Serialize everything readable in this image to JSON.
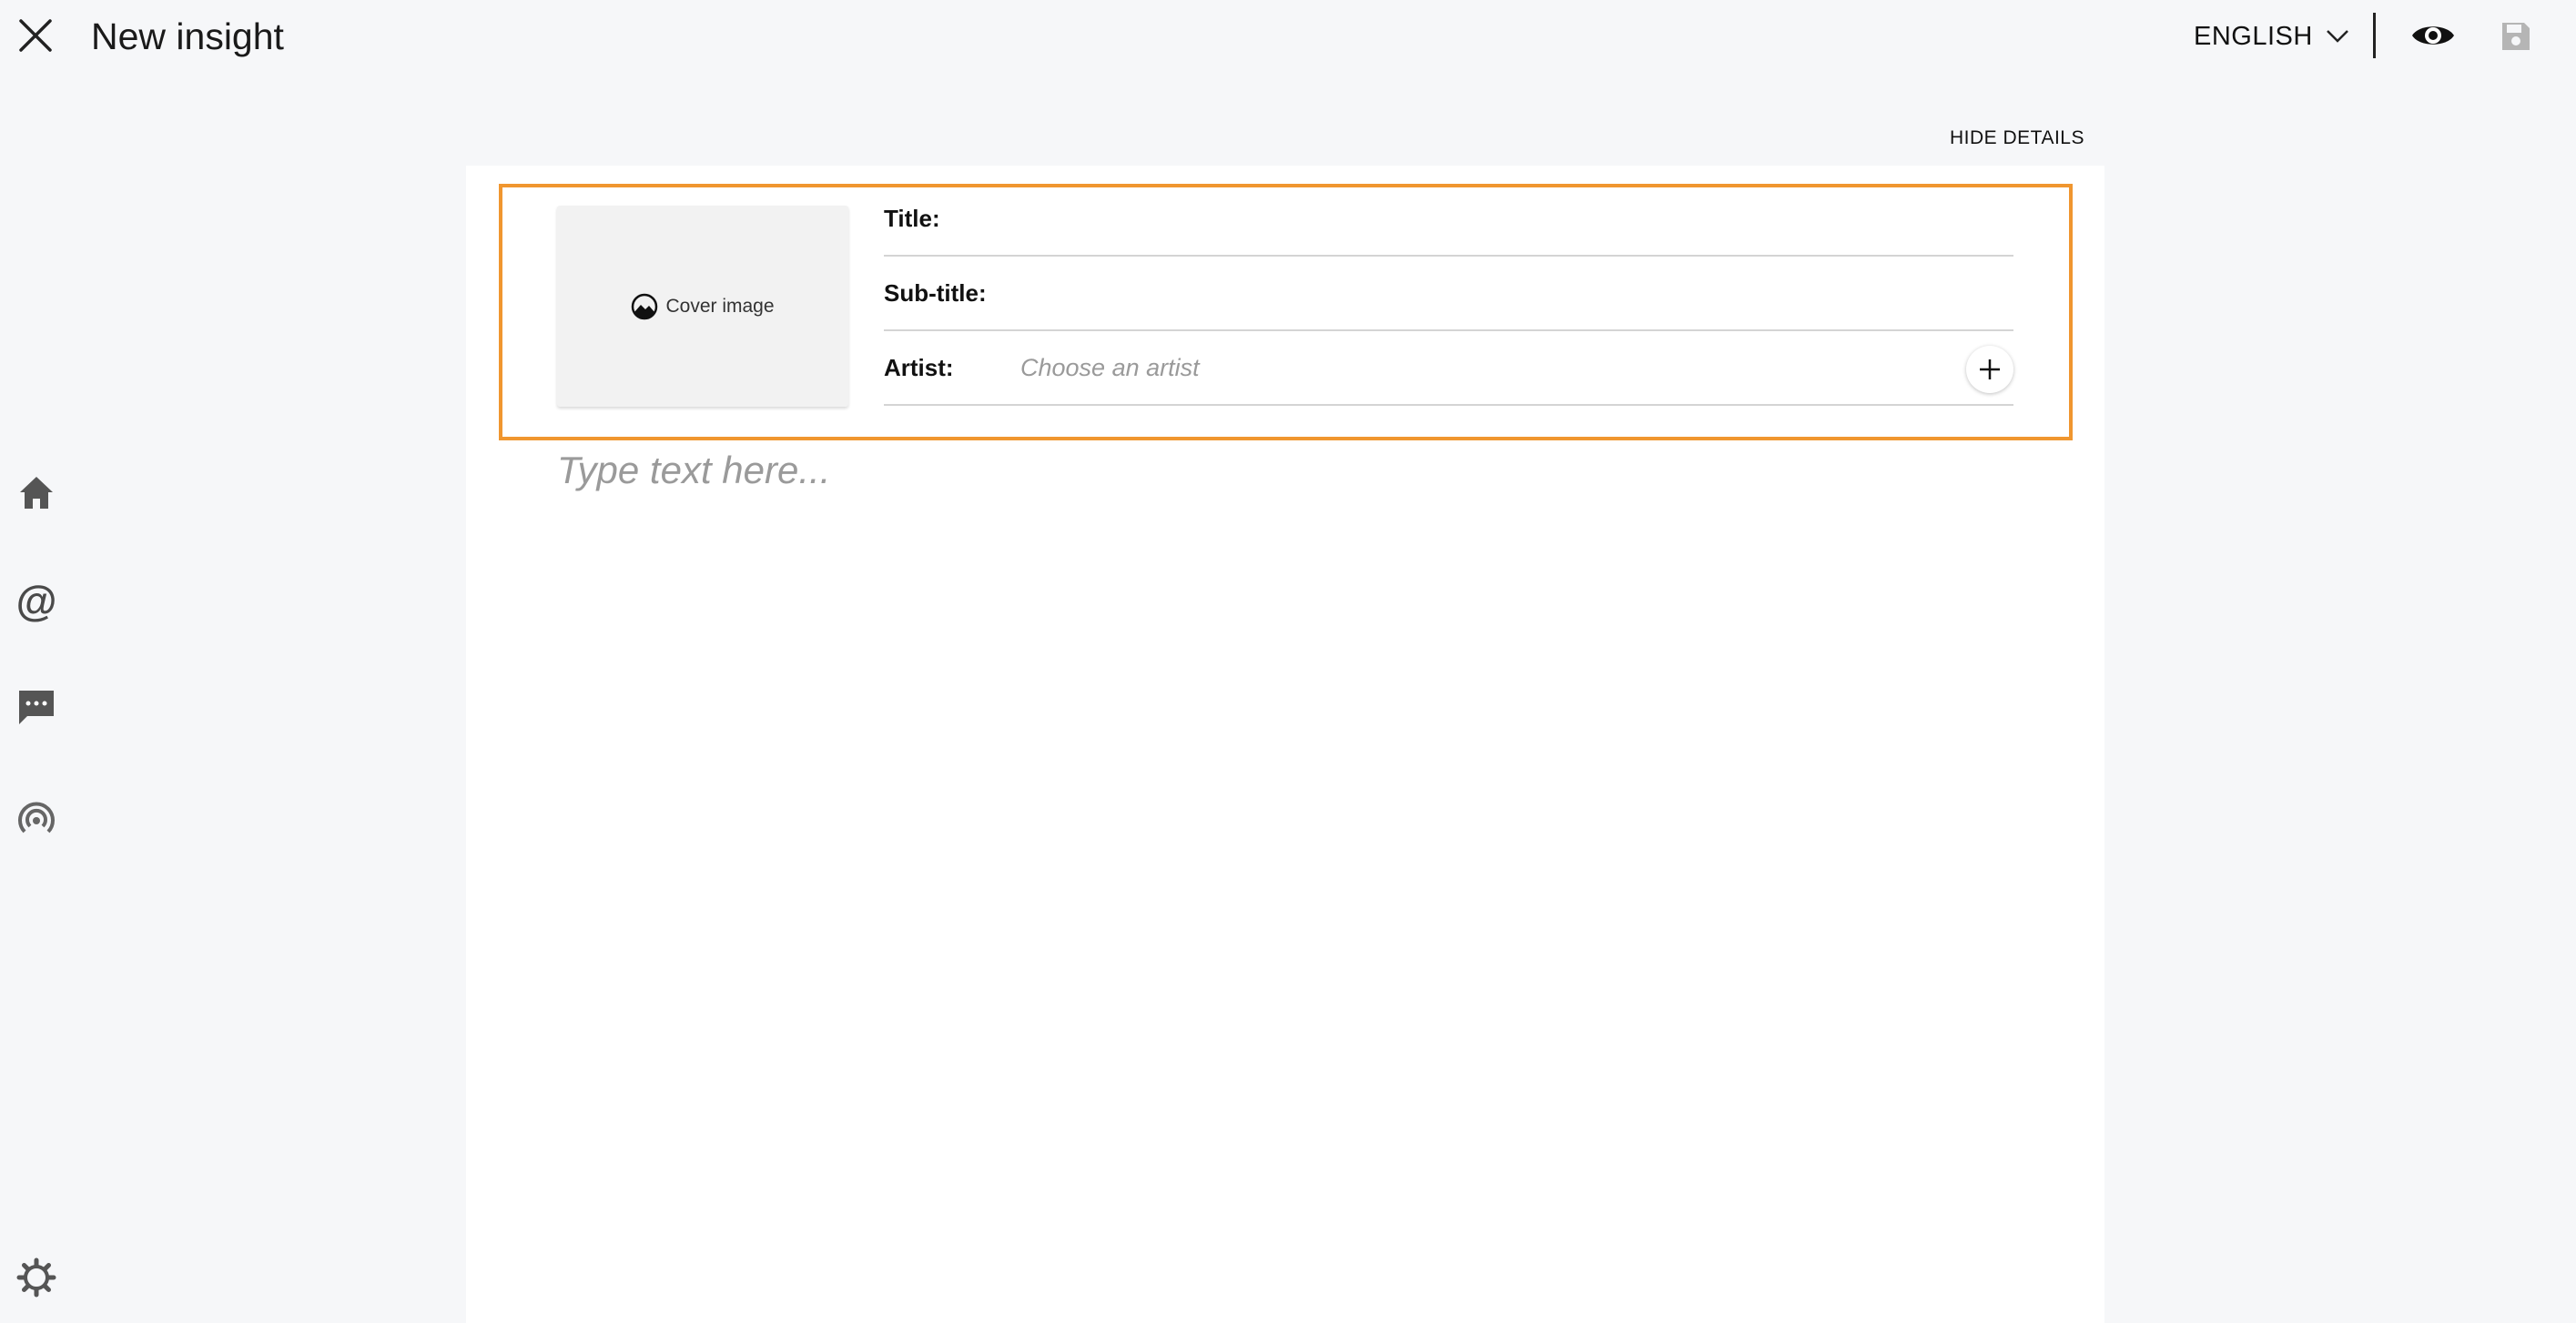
{
  "header": {
    "title": "New insight",
    "language": "ENGLISH",
    "icons": {
      "close": "close-icon",
      "language_chevron": "chevron-down-icon",
      "preview": "eye-icon",
      "save": "save-icon"
    }
  },
  "sidebar": {
    "items": [
      {
        "name": "home",
        "icon": "home-icon"
      },
      {
        "name": "mentions",
        "icon": "at-icon",
        "glyph": "@"
      },
      {
        "name": "messages",
        "icon": "chat-icon"
      },
      {
        "name": "broadcast",
        "icon": "broadcast-icon"
      }
    ],
    "footer_icon": "gear-icon"
  },
  "details": {
    "toggle_label": "HIDE DETAILS",
    "cover_label": "Cover image",
    "title_label": "Title:",
    "title_value": "",
    "subtitle_label": "Sub-title:",
    "subtitle_value": "",
    "artist_label": "Artist:",
    "artist_placeholder": "Choose an artist",
    "accent_color": "#f0962f"
  },
  "editor": {
    "placeholder": "Type text here..."
  }
}
